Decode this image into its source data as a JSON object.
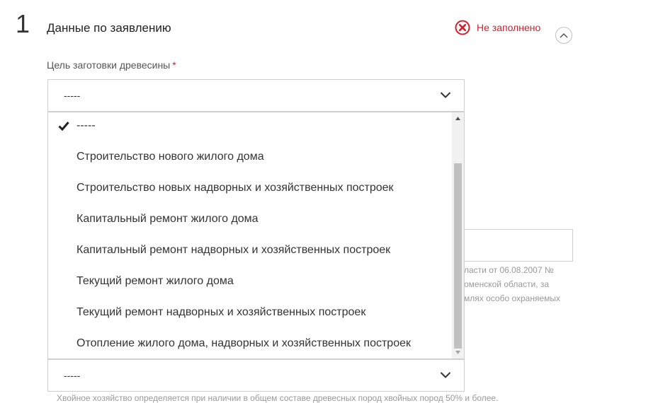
{
  "section": {
    "number": "1",
    "title": "Данные по заявлению",
    "status_text": "Не заполнено",
    "status_icon": "x-circle-icon",
    "collapse_icon": "chevron-up-icon"
  },
  "field": {
    "label": "Цель заготовки древесины",
    "required_mark": "*",
    "selected_value": "-----",
    "options": [
      "-----",
      "Строительство нового жилого дома",
      "Строительство новых надворных и хозяйственных построек",
      "Капитальный ремонт жилого дома",
      "Капитальный ремонт надворных и хозяйственных построек",
      "Текущий ремонт жилого дома",
      "Текущий ремонт надворных и хозяйственных построек",
      "Отопление жилого дома, надворных и хозяйственных построек"
    ]
  },
  "background": {
    "hint_lines": [
      "ласти от 06.08.2007 №",
      "оменской области, за",
      "млях особо охраняемых"
    ],
    "second_select_value": "-----",
    "bottom_hint": "Хвойное хозяйство определяется при наличии в общем составе древесных пород хвойных пород 50% и более."
  },
  "colors": {
    "error": "#d0202e",
    "border": "#cfcfcf"
  }
}
